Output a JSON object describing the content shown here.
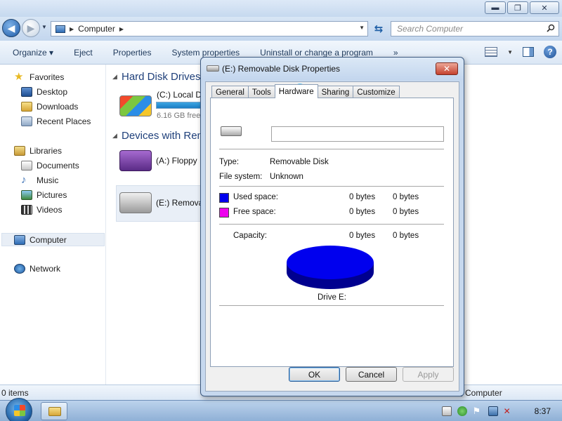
{
  "explorer": {
    "window_buttons": {
      "minimize": "▬",
      "maximize": "❐",
      "close": "✕"
    },
    "address": {
      "location": "Computer"
    },
    "search": {
      "placeholder": "Search Computer"
    },
    "toolbar": {
      "organize": "Organize ▾",
      "eject": "Eject",
      "properties": "Properties",
      "system_properties": "System properties",
      "uninstall": "Uninstall or change a program",
      "more": "»"
    },
    "nav": {
      "favorites": "Favorites",
      "desktop": "Desktop",
      "downloads": "Downloads",
      "recent": "Recent Places",
      "libraries": "Libraries",
      "documents": "Documents",
      "music": "Music",
      "pictures": "Pictures",
      "videos": "Videos",
      "computer": "Computer",
      "network": "Network"
    },
    "content": {
      "hard_disk_header": "Hard Disk Drives",
      "local_disk": "(C:) Local D",
      "local_disk_free": "6.16 GB free",
      "devices_header": "Devices with Rem",
      "floppy": "(A:) Floppy",
      "removable": "(E:) Remova"
    },
    "status": {
      "items": "0 items",
      "location": "Computer"
    }
  },
  "dialog": {
    "title": "(E:) Removable Disk Properties",
    "close": "✕",
    "tabs": [
      "General",
      "Tools",
      "Hardware",
      "Sharing",
      "Customize"
    ],
    "label_value": "",
    "type_label": "Type:",
    "type_value": "Removable Disk",
    "fs_label": "File system:",
    "fs_value": "Unknown",
    "used_label": "Used space:",
    "used_bytes": "0 bytes",
    "used_size": "0 bytes",
    "free_label": "Free space:",
    "free_bytes": "0 bytes",
    "free_size": "0 bytes",
    "capacity_label": "Capacity:",
    "capacity_bytes": "0 bytes",
    "capacity_size": "0 bytes",
    "drive_caption": "Drive E:",
    "used_color": "#0000ee",
    "free_color": "#ee00ee",
    "ok": "OK",
    "cancel": "Cancel",
    "apply": "Apply"
  },
  "taskbar": {
    "clock": "8:37"
  }
}
